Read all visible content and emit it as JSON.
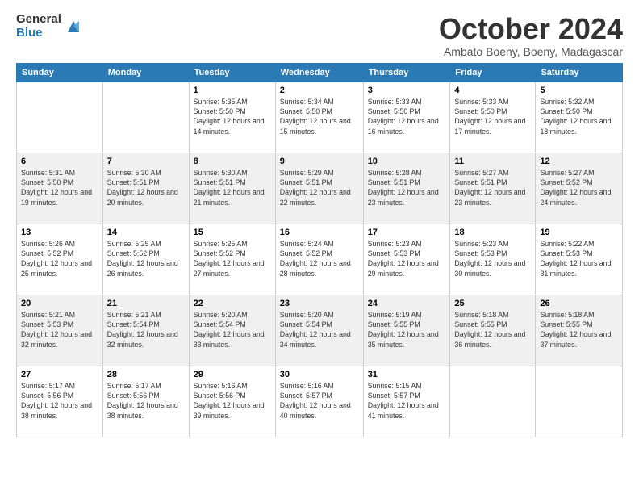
{
  "logo": {
    "general": "General",
    "blue": "Blue"
  },
  "title": "October 2024",
  "subtitle": "Ambato Boeny, Boeny, Madagascar",
  "headers": [
    "Sunday",
    "Monday",
    "Tuesday",
    "Wednesday",
    "Thursday",
    "Friday",
    "Saturday"
  ],
  "weeks": [
    [
      {
        "day": "",
        "info": ""
      },
      {
        "day": "",
        "info": ""
      },
      {
        "day": "1",
        "info": "Sunrise: 5:35 AM\nSunset: 5:50 PM\nDaylight: 12 hours and 14 minutes."
      },
      {
        "day": "2",
        "info": "Sunrise: 5:34 AM\nSunset: 5:50 PM\nDaylight: 12 hours and 15 minutes."
      },
      {
        "day": "3",
        "info": "Sunrise: 5:33 AM\nSunset: 5:50 PM\nDaylight: 12 hours and 16 minutes."
      },
      {
        "day": "4",
        "info": "Sunrise: 5:33 AM\nSunset: 5:50 PM\nDaylight: 12 hours and 17 minutes."
      },
      {
        "day": "5",
        "info": "Sunrise: 5:32 AM\nSunset: 5:50 PM\nDaylight: 12 hours and 18 minutes."
      }
    ],
    [
      {
        "day": "6",
        "info": "Sunrise: 5:31 AM\nSunset: 5:50 PM\nDaylight: 12 hours and 19 minutes."
      },
      {
        "day": "7",
        "info": "Sunrise: 5:30 AM\nSunset: 5:51 PM\nDaylight: 12 hours and 20 minutes."
      },
      {
        "day": "8",
        "info": "Sunrise: 5:30 AM\nSunset: 5:51 PM\nDaylight: 12 hours and 21 minutes."
      },
      {
        "day": "9",
        "info": "Sunrise: 5:29 AM\nSunset: 5:51 PM\nDaylight: 12 hours and 22 minutes."
      },
      {
        "day": "10",
        "info": "Sunrise: 5:28 AM\nSunset: 5:51 PM\nDaylight: 12 hours and 23 minutes."
      },
      {
        "day": "11",
        "info": "Sunrise: 5:27 AM\nSunset: 5:51 PM\nDaylight: 12 hours and 23 minutes."
      },
      {
        "day": "12",
        "info": "Sunrise: 5:27 AM\nSunset: 5:52 PM\nDaylight: 12 hours and 24 minutes."
      }
    ],
    [
      {
        "day": "13",
        "info": "Sunrise: 5:26 AM\nSunset: 5:52 PM\nDaylight: 12 hours and 25 minutes."
      },
      {
        "day": "14",
        "info": "Sunrise: 5:25 AM\nSunset: 5:52 PM\nDaylight: 12 hours and 26 minutes."
      },
      {
        "day": "15",
        "info": "Sunrise: 5:25 AM\nSunset: 5:52 PM\nDaylight: 12 hours and 27 minutes."
      },
      {
        "day": "16",
        "info": "Sunrise: 5:24 AM\nSunset: 5:52 PM\nDaylight: 12 hours and 28 minutes."
      },
      {
        "day": "17",
        "info": "Sunrise: 5:23 AM\nSunset: 5:53 PM\nDaylight: 12 hours and 29 minutes."
      },
      {
        "day": "18",
        "info": "Sunrise: 5:23 AM\nSunset: 5:53 PM\nDaylight: 12 hours and 30 minutes."
      },
      {
        "day": "19",
        "info": "Sunrise: 5:22 AM\nSunset: 5:53 PM\nDaylight: 12 hours and 31 minutes."
      }
    ],
    [
      {
        "day": "20",
        "info": "Sunrise: 5:21 AM\nSunset: 5:53 PM\nDaylight: 12 hours and 32 minutes."
      },
      {
        "day": "21",
        "info": "Sunrise: 5:21 AM\nSunset: 5:54 PM\nDaylight: 12 hours and 32 minutes."
      },
      {
        "day": "22",
        "info": "Sunrise: 5:20 AM\nSunset: 5:54 PM\nDaylight: 12 hours and 33 minutes."
      },
      {
        "day": "23",
        "info": "Sunrise: 5:20 AM\nSunset: 5:54 PM\nDaylight: 12 hours and 34 minutes."
      },
      {
        "day": "24",
        "info": "Sunrise: 5:19 AM\nSunset: 5:55 PM\nDaylight: 12 hours and 35 minutes."
      },
      {
        "day": "25",
        "info": "Sunrise: 5:18 AM\nSunset: 5:55 PM\nDaylight: 12 hours and 36 minutes."
      },
      {
        "day": "26",
        "info": "Sunrise: 5:18 AM\nSunset: 5:55 PM\nDaylight: 12 hours and 37 minutes."
      }
    ],
    [
      {
        "day": "27",
        "info": "Sunrise: 5:17 AM\nSunset: 5:56 PM\nDaylight: 12 hours and 38 minutes."
      },
      {
        "day": "28",
        "info": "Sunrise: 5:17 AM\nSunset: 5:56 PM\nDaylight: 12 hours and 38 minutes."
      },
      {
        "day": "29",
        "info": "Sunrise: 5:16 AM\nSunset: 5:56 PM\nDaylight: 12 hours and 39 minutes."
      },
      {
        "day": "30",
        "info": "Sunrise: 5:16 AM\nSunset: 5:57 PM\nDaylight: 12 hours and 40 minutes."
      },
      {
        "day": "31",
        "info": "Sunrise: 5:15 AM\nSunset: 5:57 PM\nDaylight: 12 hours and 41 minutes."
      },
      {
        "day": "",
        "info": ""
      },
      {
        "day": "",
        "info": ""
      }
    ]
  ]
}
